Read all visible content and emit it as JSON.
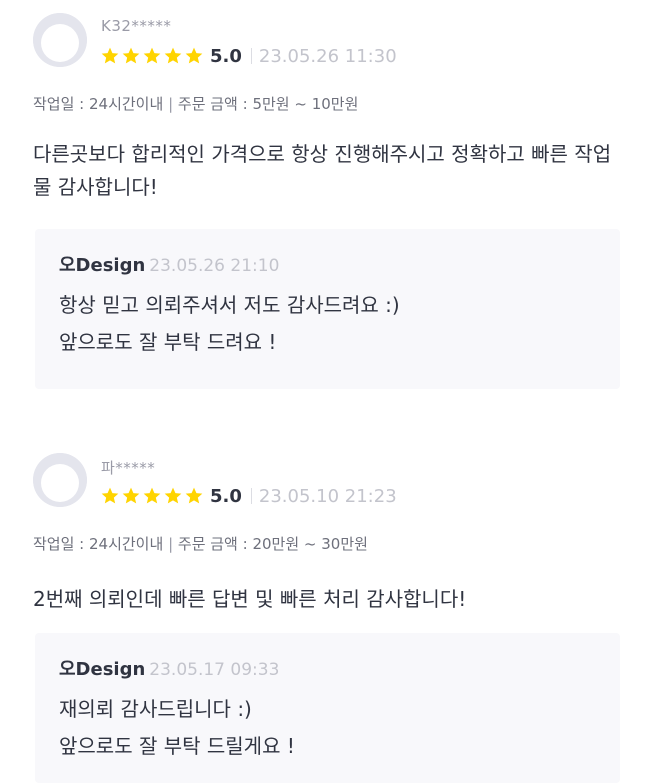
{
  "reviews": [
    {
      "user": "K32*****",
      "score": "5.0",
      "date": "23.05.26 11:30",
      "stars": 5,
      "work_days_label": "작업일 : 24시간이내",
      "order_amount_label": "주문 금액 : 5만원 ~ 10만원",
      "text": "다른곳보다 합리적인 가격으로 항상 진행해주시고 정확하고 빠른 작업물 감사합니다!",
      "reply": {
        "name": "오Design",
        "date": "23.05.26 21:10",
        "lines": [
          "항상 믿고 의뢰주셔서 저도 감사드려요 :)",
          "앞으로도 잘 부탁 드려요 !"
        ]
      }
    },
    {
      "user": "파*****",
      "score": "5.0",
      "date": "23.05.10 21:23",
      "stars": 5,
      "work_days_label": "작업일 : 24시간이내",
      "order_amount_label": "주문 금액 : 20만원 ~ 30만원",
      "text": "2번째 의뢰인데 빠른 답변 및 빠른 처리 감사합니다!",
      "reply": {
        "name": "오Design",
        "date": "23.05.17 09:33",
        "lines": [
          "재의뢰 감사드립니다 :)",
          "앞으로도 잘 부탁 드릴게요 !"
        ]
      }
    }
  ],
  "colors": {
    "star": "#ffd400",
    "reply_bg": "#f8f8fb",
    "avatar_bg": "#e4e5ed"
  },
  "icons": {
    "star": "star-icon",
    "avatar": "default-avatar-icon"
  }
}
